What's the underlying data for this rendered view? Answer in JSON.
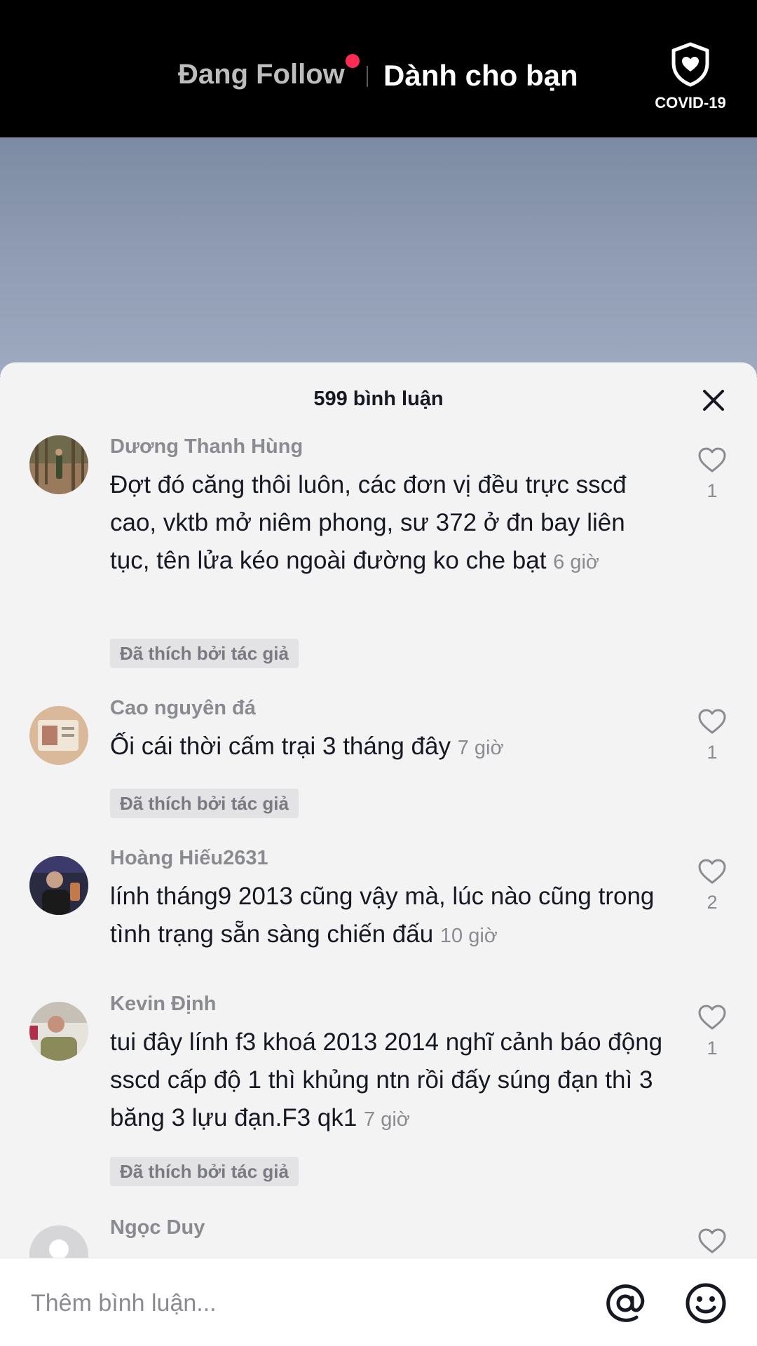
{
  "header": {
    "tab_following": "Đang Follow",
    "tab_for_you": "Dành cho bạn",
    "covid_label": "COVID-19"
  },
  "comments_panel": {
    "title": "599 bình luận",
    "comments": [
      {
        "author": "Dương Thanh Hùng",
        "text": "Đợt đó căng thôi luôn, các đơn vị đều trực sscđ cao, vktb mở niêm phong, sư 372 ở đn bay liên tục, tên lửa kéo ngoài đường ko che bạt",
        "time": "6 giờ",
        "liked_by_author": "Đã thích bởi tác giả",
        "likes": "1"
      },
      {
        "author": "Cao nguyên đá",
        "text": "Ối cái thời cấm trại 3 tháng đây",
        "time": "7 giờ",
        "liked_by_author": "Đã thích bởi tác giả",
        "likes": "1"
      },
      {
        "author": "Hoàng Hiếu2631",
        "text": "lính tháng9 2013 cũng vậy mà, lúc nào cũng trong tình trạng sẵn sàng chiến đấu",
        "time": "10 giờ",
        "likes": "2"
      },
      {
        "author": "Kevin Định",
        "text": "tui đây lính f3 khoá 2013 2014 nghĩ cảnh báo động sscd cấp độ 1 thì khủng ntn rồi đấy súng đạn thì 3 băng 3 lựu đạn.F3 qk1",
        "time": "7 giờ",
        "liked_by_author": "Đã thích bởi tác giả",
        "likes": "1"
      },
      {
        "author": "Ngọc Duy"
      }
    ]
  },
  "input": {
    "placeholder": "Thêm bình luận..."
  },
  "colors": {
    "accent_dot": "#fe2c55",
    "sheet_bg": "#f3f3f4",
    "secondary_text": "#8a8b91"
  }
}
